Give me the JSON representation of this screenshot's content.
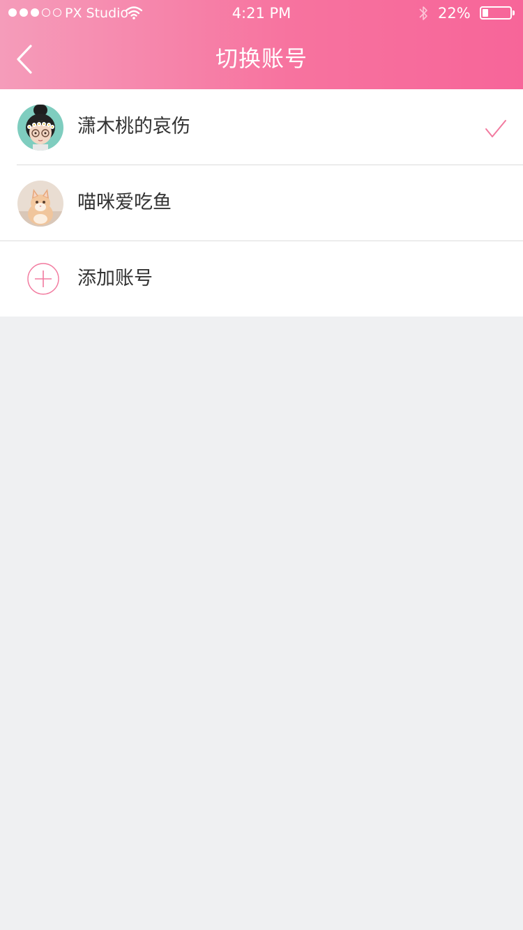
{
  "status_bar": {
    "carrier": "PX Studio",
    "time": "4:21 PM",
    "battery_percent_label": "22%",
    "battery_level": 0.22,
    "signal_bars_filled": 3,
    "signal_bars_total": 5
  },
  "nav": {
    "title": "切换账号",
    "back_icon": "chevron-left-icon"
  },
  "accounts": [
    {
      "name": "潇木桃的哀伤",
      "avatar": "girl-avatar",
      "selected": true
    },
    {
      "name": "喵咪爱吃鱼",
      "avatar": "cat-avatar",
      "selected": false
    }
  ],
  "add_account": {
    "label": "添加账号",
    "icon": "plus-circle-icon"
  },
  "colors": {
    "header_gradient_start": "#f59cba",
    "header_gradient_end": "#f76599",
    "accent": "#f27a9f",
    "background": "#eff0f2"
  }
}
